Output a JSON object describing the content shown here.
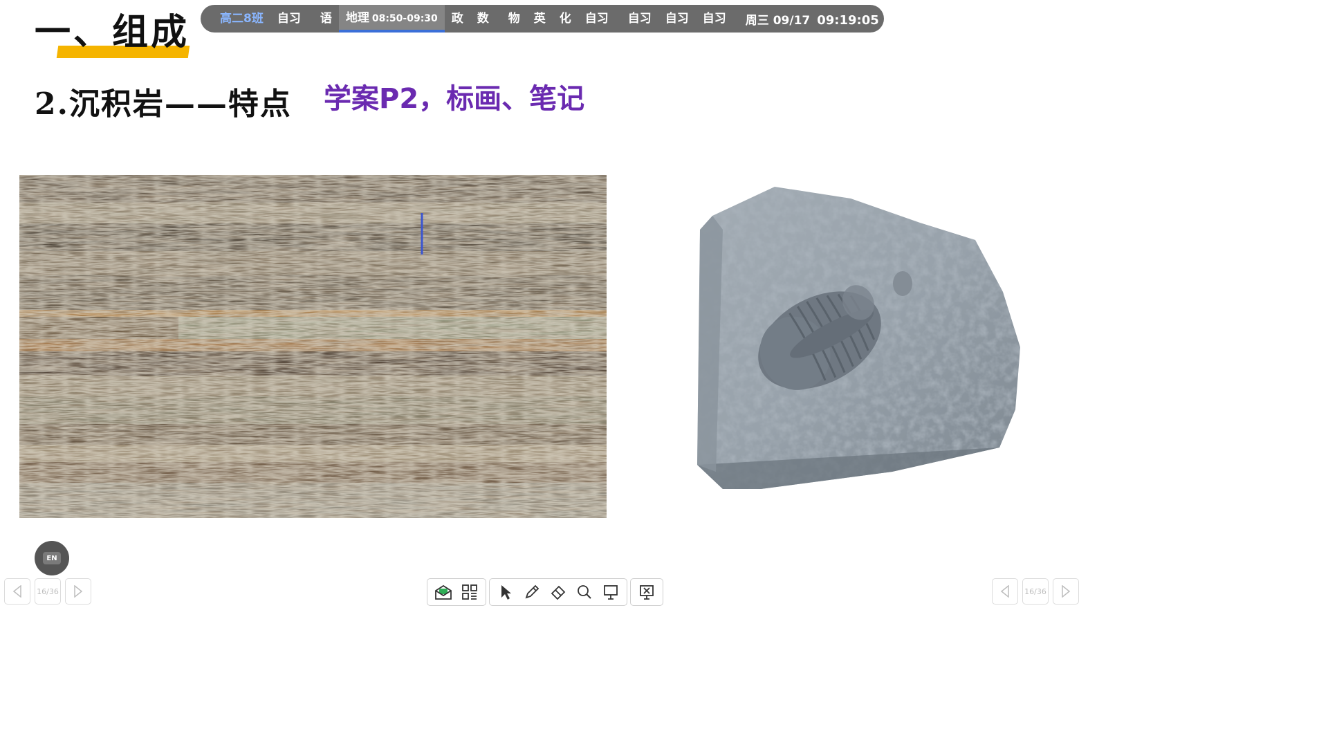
{
  "slide": {
    "heading": "一、组成",
    "subheading": "2.沉积岩——特点",
    "note": "学案P2，标画、笔记"
  },
  "schedule": {
    "class_name": "高二8班",
    "items": [
      {
        "label": "自习"
      },
      {
        "label": "语"
      },
      {
        "label": "地理",
        "time": "08:50-09:30",
        "active": true
      },
      {
        "label": "政"
      },
      {
        "label": "数"
      },
      {
        "label": "物"
      },
      {
        "label": "英"
      },
      {
        "label": "化"
      },
      {
        "label": "自习"
      },
      {
        "label": "自习"
      },
      {
        "label": "自习"
      },
      {
        "label": "自习"
      }
    ],
    "weekday_date": "周三 09/17",
    "clock": "09:19:05"
  },
  "lang_button": {
    "label": "EN"
  },
  "pager_left": {
    "page": "16/36"
  },
  "pager_right": {
    "page": "16/36"
  },
  "toolbar": {
    "tools": [
      "envelope-icon",
      "apps-grid-icon",
      "pointer-icon",
      "pen-icon",
      "eraser-icon",
      "magnifier-icon",
      "whiteboard-icon",
      "exit-slideshow-icon"
    ]
  },
  "colors": {
    "accent_underline": "#f5b400",
    "note_purple": "#6a2ab0",
    "schedule_bg": "#6b6b6b",
    "active_tab_line": "#3b6fd8",
    "class_name_blue": "#8ab6ff"
  }
}
